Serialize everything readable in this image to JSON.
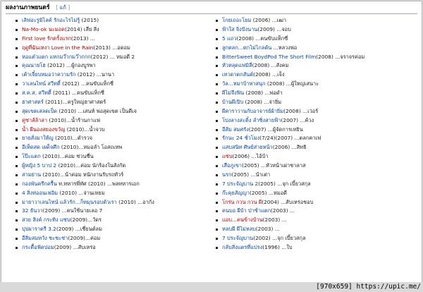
{
  "section": {
    "title": "ผลงานภาพยนตร์",
    "edit_open": "[",
    "edit_label": "แก้",
    "edit_close": "]"
  },
  "left_items": [
    {
      "link": "เลิฟอะรูมิไลค์ รักอะไรไม่รู้",
      "rest": " (2015)",
      "red": false
    },
    {
      "link": "Na-Mo-ok นะมอค",
      "rest": "(2014) เสี่ย สิ่ง",
      "red": true
    },
    {
      "link": "First love รักครั้งแรก",
      "rest": "(2013) ...",
      "red": true
    },
    {
      "link": "ฤดูที่ฉันเหงา Love in the Rain",
      "rest": "(2013) ...อดอม",
      "red": true
    },
    {
      "link": "หอแต๋วแตก แหกมว๊ากมว๊ากกก",
      "rest": "(2012) ... หมอดี 2",
      "red": false
    },
    {
      "link": "คุณนายโฮ",
      "rest": " (2012) ...ผู้กองบูรพา",
      "red": false
    },
    {
      "link": "เต้าเจี๋ยบหมอว่าความรัก",
      "rest": " (2012) ...นานา",
      "red": false
    },
    {
      "link": "วาเลนไทน์ สวีทตี้",
      "rest": " (2012) ...คนขับแท็กซี่",
      "red": false
    },
    {
      "link": "ส.ค.ส. สวีทตี้",
      "rest": " (2011) ...คนขับแท็กซี่",
      "red": false
    },
    {
      "link": "ฮาศาสตร์",
      "rest": " (2011)...ครูใหญ่ฮาศาสตร์",
      "red": false
    },
    {
      "link": "สุดเขตเสลดเป็ด",
      "rest": " (2010) ...เสนห์ พ่อสุดเขต เป็นดีเจ",
      "red": false
    },
    {
      "link": "คู่ซ่าส์ล้าล่า",
      "rest": " (2010)...น้ำร้านกาแฟ",
      "red": true
    },
    {
      "link": "น้ำ ผีนองสยองขวัญ",
      "rest": " (2010)...น้ำจวบ",
      "red": true
    },
    {
      "link": "ยายสั่งมาให้ญู",
      "rest": " (2010)...ตำรวจ",
      "red": false
    },
    {
      "link": "อีเห็ดสด เผด็จศึก",
      "rest": " (2010)...หมอลำ โอสถเทพ",
      "red": false
    },
    {
      "link": "โป๊ะแตก",
      "rest": " (2010)...ค่อม ช่วนชื่น",
      "red": false
    },
    {
      "link": "ผู้หญิง 5 บาป 2",
      "rest": " (2010)...ค่อม นักร้องในสังกัด",
      "red": false
    },
    {
      "link": "สามย่าน",
      "rest": " (2010)...น้าค่อม หนักงานรับรถทัวร์",
      "red": false
    },
    {
      "link": "กองพันครึกครื้น",
      "rest": " ท.ทหารพี่ทัศ (2010) ...พลทหารเอก",
      "red": false
    },
    {
      "link": "4 สิ่งห่ออนเฟอิม",
      "rest": " (2010) ...จ่านเหยม",
      "red": false
    },
    {
      "link": "มายาวาเลนไทน์ แล้วรัก...ก็หมุนรอบตัวเรา",
      "rest": " (2010) ...อากัง",
      "red": false
    },
    {
      "link": "32 ธันวา",
      "rest": "(2009) ...คนใช้นายเลอ 7",
      "red": false
    },
    {
      "link": "สวย สิงค์ กระทิง แซ่บ",
      "rest": "(2009)...วัดร",
      "red": false
    },
    {
      "link": "ปุปผาราตรี 3.2",
      "rest": "(2009) ...เชี่ยนต์ลม",
      "red": false
    },
    {
      "link": "อีสิ่มสมหวัง ชะชะช่า",
      "rest": "(2009)...ค่อม",
      "red": false
    },
    {
      "link": "กระดื้อฟัดปอม",
      "rest": "(2009) ...สับเหร่อ",
      "red": false
    }
  ],
  "right_items": [
    {
      "link": "โกยเถอะโยม",
      "rest": " (2006) ...เฒ่า",
      "red": false
    },
    {
      "link": "ฟ้าใส จิ่งปังนาน",
      "rest": "(2009) ...จอบ",
      "red": false
    },
    {
      "link": "5 แถว",
      "rest": "(2008) ...คนขับแท็กซี่",
      "red": false
    },
    {
      "link": "ลูกตลก...ตกไม่ไกลต้น",
      "rest": " ...หลวงพ่อ",
      "red": false
    },
    {
      "link": "BitterSweet BoydPod The Short Film",
      "rest": "(2008) ...จราจรค่อม",
      "red": false
    },
    {
      "link": "หัวหลุดแฟมิลี่",
      "rest": "(2008) ...สังคม",
      "red": false
    },
    {
      "link": "เทวดาตกสันต์",
      "rest": "(2008) ...เจ็ง",
      "red": false
    },
    {
      "link": "วัล...หมาบ้าหาสนุก",
      "rest": " (2008) ...ผู้ใหญ่เสนาะ",
      "red": false
    },
    {
      "link": "ผีไม่จึงฟิน",
      "rest": " (2008) ...พ่อดำ",
      "red": false
    },
    {
      "link": "บ้านผีเปิบ",
      "rest": " (2008) ...จ่ายิ่ม",
      "red": false
    },
    {
      "link": "ผีคาราวานกับอาจารย์ผ้ายิ่ม",
      "rest": "(2008) ...เว่อร์",
      "red": false
    },
    {
      "link": "โปงลางสะดิ้ง ลำซิ่งสายฟ้า",
      "rest": "(2007) ...ค้วง",
      "red": false
    },
    {
      "link": "อีส้ม สมศรัง",
      "rest": "(2007) ...ผู้จัดการเหยิน",
      "red": false
    },
    {
      "link": "รักนะ 24 ชั่วโมง",
      "rest": "(7/24)(2007) ...ตลกคาเฟ",
      "red": false
    },
    {
      "link": "แสบสนิท ศิษย์ส่ายหน้า",
      "rest": "(2006) ...สิทธิ",
      "red": false
    },
    {
      "link": "แซ่บ",
      "rest": "(2006) ...ไอ้บ้า",
      "red": true
    },
    {
      "link": "เสือภูเขา",
      "rest": "(2005) ...หัวหน้าเผ่าชาลาส",
      "red": false
    },
    {
      "link": "นรก",
      "rest": "(2005) ...น้าเต่า",
      "red": false
    },
    {
      "link": "7 ประจัญบาน 2",
      "rest": "(2005) ...จุก เบี้ยวสกุล",
      "red": false
    },
    {
      "link": "ก๊ะคุยสัญญา",
      "rest": "(2005) ...หมอดี",
      "red": false
    },
    {
      "link": "โกร่น กวน กวน ผี",
      "rest": "(2004) ...สับเหร่อชอบ",
      "red": true
    },
    {
      "link": "คนบอ ผีบ้า ป่าซ้าแตก",
      "rest": "(2003) ...",
      "red": false
    },
    {
      "link": "แอบ...คนข้างบ้าน",
      "rest": "(2003) ...",
      "red": true
    },
    {
      "link": "หลบผี ผีไม่หลบ",
      "rest": "(2003) ...",
      "red": false
    },
    {
      "link": "7 ประจัญบาน",
      "rest": "(2002) ...จุก เบี้ยวสกุล",
      "red": false
    },
    {
      "link": "กลับสิ่งแตรที่แปรง",
      "rest": "(1996) ...ใบ",
      "red": false
    }
  ],
  "watermark": "[970x659] https://upic.me/"
}
